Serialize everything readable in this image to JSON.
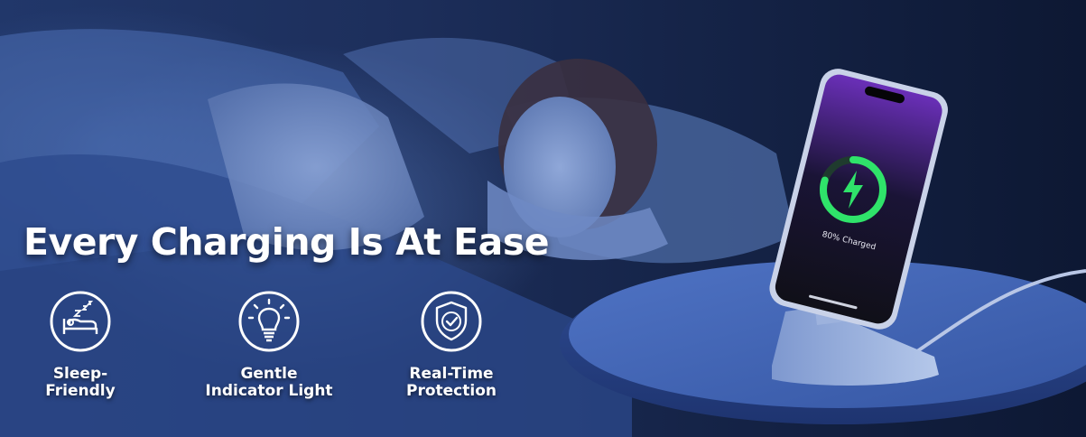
{
  "headline": "Every Charging Is At Ease",
  "features": [
    {
      "icon": "sleeping-in-bed-icon",
      "label": "Sleep-\nFriendly"
    },
    {
      "icon": "light-bulb-icon",
      "label": "Gentle\nIndicator Light"
    },
    {
      "icon": "shield-check-icon",
      "label": "Real-Time\nProtection"
    }
  ],
  "phone": {
    "status": "80% Charged",
    "charge_fraction": 0.8
  },
  "colors": {
    "charge_ring": "#2fe36a",
    "text": "#ffffff"
  }
}
